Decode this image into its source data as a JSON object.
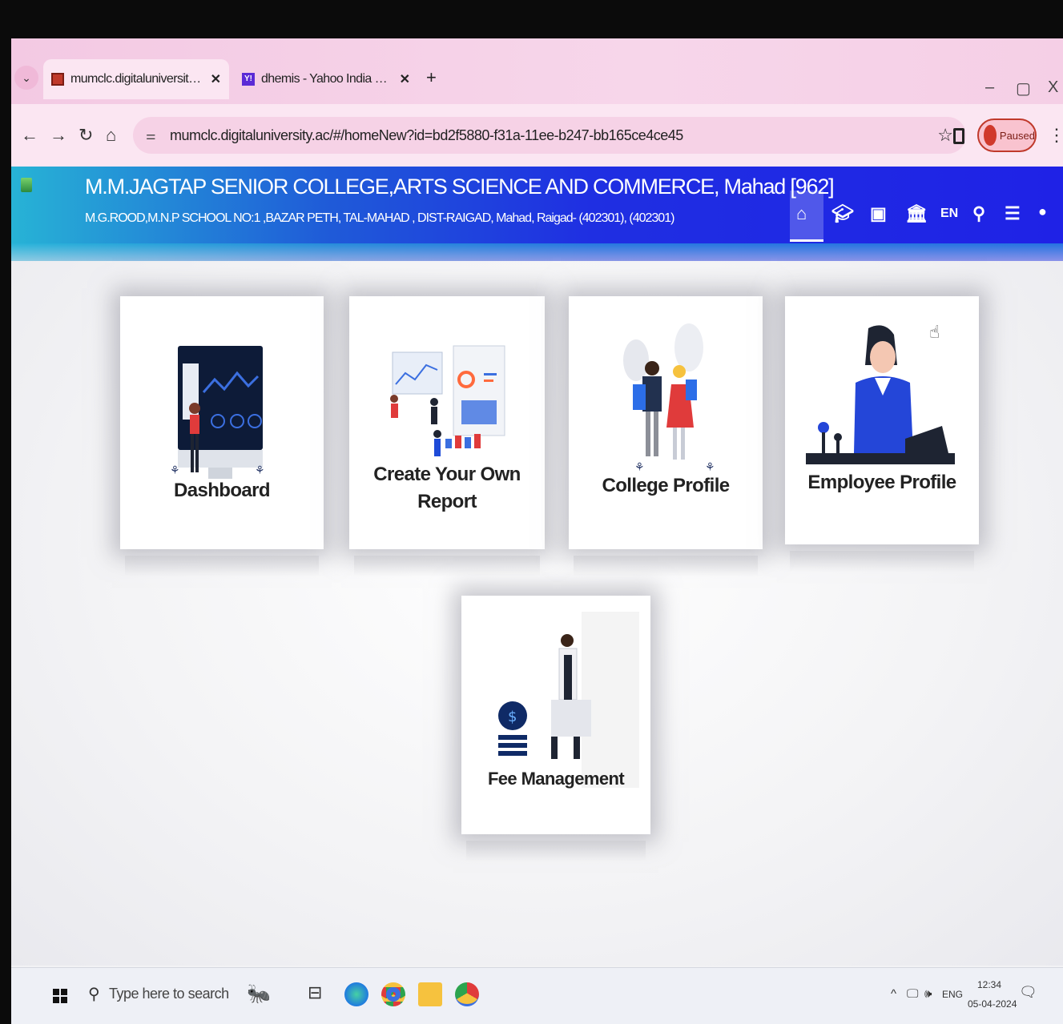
{
  "browser": {
    "tabs": [
      {
        "title": "mumclc.digitaluniversity.ac/#/h",
        "active": true
      },
      {
        "title": "dhemis - Yahoo India Search Re",
        "active": false
      }
    ],
    "new_tab": "+",
    "window_controls": {
      "minimize": "–",
      "maximize": "▢",
      "close": "X"
    },
    "url": "mumclc.digitaluniversity.ac/#/homeNew?id=bd2f5880-f31a-11ee-b247-bb165ce4ce45",
    "profile_label": "Paused"
  },
  "header": {
    "college_name": "M.M.JAGTAP SENIOR COLLEGE,ARTS SCIENCE AND COMMERCE, Mahad [962]",
    "address": "M.G.ROOD,M.N.P SCHOOL NO:1 ,BAZAR PETH, TAL-MAHAD , DIST-RAIGAD, Mahad, Raigad- (402301), (402301)",
    "language": "EN",
    "colors": {
      "gradient_start": "#27b3d6",
      "gradient_end": "#1f22e6"
    }
  },
  "tiles": [
    {
      "label": "Dashboard",
      "icon": "dashboard-illustration"
    },
    {
      "label": "Create Your Own Report",
      "icon": "report-illustration"
    },
    {
      "label": "College Profile",
      "icon": "students-illustration"
    },
    {
      "label": "Employee Profile",
      "icon": "employee-illustration"
    },
    {
      "label": "Fee Management",
      "icon": "fee-illustration"
    }
  ],
  "taskbar": {
    "search_placeholder": "Type here to search",
    "language": "ENG",
    "time": "12:34",
    "date": "05-04-2024"
  }
}
